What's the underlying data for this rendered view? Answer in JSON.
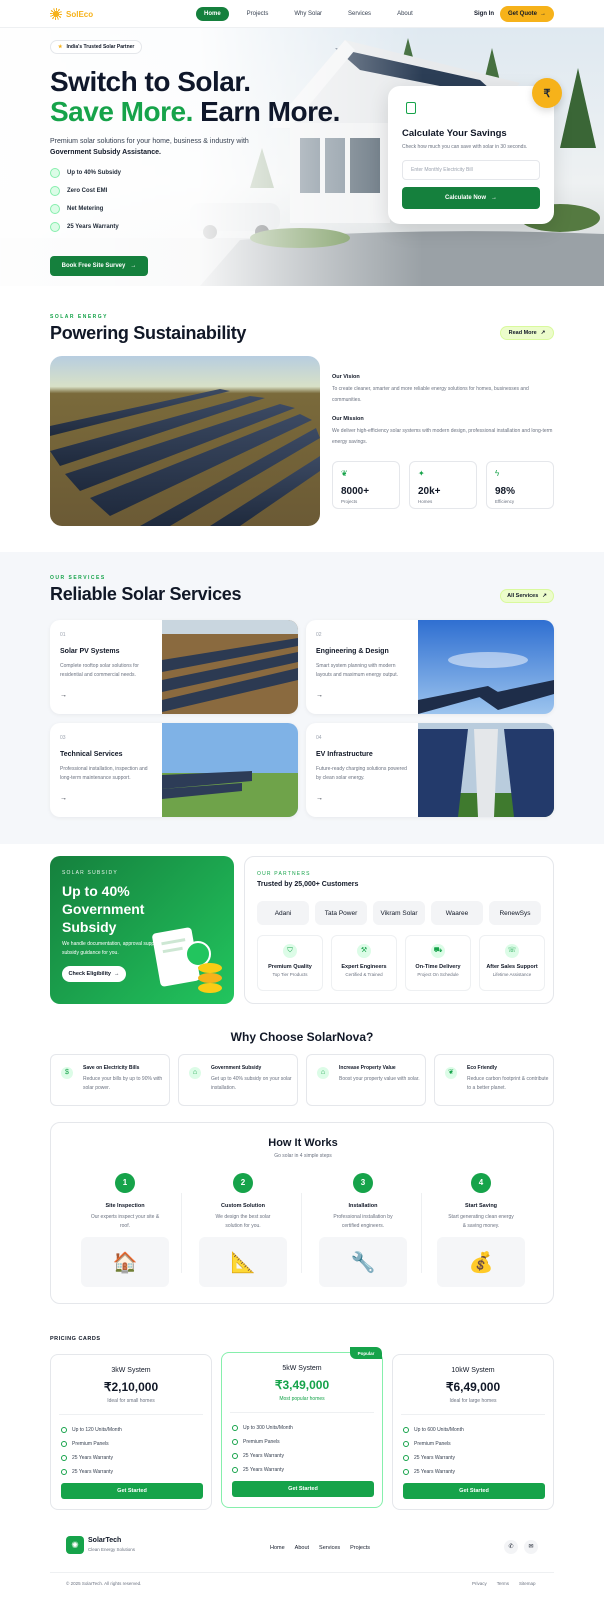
{
  "header": {
    "logo": "SolEco",
    "nav": [
      "Home",
      "Projects",
      "Why Solar",
      "Services",
      "About"
    ],
    "sign_in": "Sign In",
    "get_quote": "Get Quote",
    "quote_arrow": "→"
  },
  "hero": {
    "badge": "India's Trusted Solar Partner",
    "headline_1": "Switch to Solar.",
    "headline_2a": "Save More.",
    "headline_2b": " Earn More.",
    "desc": "Premium solar solutions for your home, business & industry with",
    "desc_bold": "Government Subsidy Assistance.",
    "features": [
      "Up to 40% Subsidy",
      "Zero Cost EMI",
      "Net Metering",
      "25 Years Warranty"
    ],
    "survey_button": "Book Free Site Survey",
    "arrow": "→",
    "coin": "₹"
  },
  "calculator": {
    "title": "Calculate Your Savings",
    "subtitle": "Check how much you can save with solar in 30 seconds.",
    "placeholder": "Enter Monthly Electricity Bill",
    "button": "Calculate Now",
    "arrow": "→"
  },
  "sustainability": {
    "eyebrow": "SOLAR ENERGY",
    "title": "Powering Sustainability",
    "read_more": "Read More",
    "arrow": "↗",
    "vision_title": "Our Vision",
    "vision_text": "To create cleaner, smarter and more reliable energy solutions for homes, businesses and communities.",
    "mission_title": "Our Mission",
    "mission_text": "We deliver high-efficiency solar systems with modern design, professional installation and long-term energy savings.",
    "stats": [
      {
        "icon": "leaf-icon",
        "value": "8000+",
        "label": "Projects"
      },
      {
        "icon": "sparkle-icon",
        "value": "20k+",
        "label": "Homes"
      },
      {
        "icon": "bolt-icon",
        "value": "98%",
        "label": "Efficiency"
      }
    ]
  },
  "services": {
    "eyebrow": "OUR SERVICES",
    "title": "Reliable Solar Services",
    "all_button": "All Services",
    "arrow": "↗",
    "cards": [
      {
        "num": "01",
        "title": "Solar PV Systems",
        "desc": "Complete rooftop solar solutions for residential and commercial needs.",
        "arrow": "→"
      },
      {
        "num": "02",
        "title": "Engineering & Design",
        "desc": "Smart system planning with modern layouts and maximum energy output.",
        "arrow": "→"
      },
      {
        "num": "03",
        "title": "Technical Services",
        "desc": "Professional installation, inspection and long-term maintenance support.",
        "arrow": "→"
      },
      {
        "num": "04",
        "title": "EV Infrastructure",
        "desc": "Future-ready charging solutions powered by clean solar energy.",
        "arrow": "→"
      }
    ]
  },
  "subsidy": {
    "eyebrow": "SOLAR SUBSIDY",
    "title": "Up to 40% Government Subsidy",
    "desc": "We handle documentation, approval support and subsidy guidance for you.",
    "button": "Check Eligibility",
    "arrow": "→"
  },
  "partners": {
    "eyebrow": "OUR PARTNERS",
    "title": "Trusted by 25,000+ Customers",
    "logos": [
      "Adani",
      "Tata Power",
      "Vikram Solar",
      "Waaree",
      "RenewSys"
    ],
    "features": [
      {
        "title": "Premium Quality",
        "sub": "Top Tier Products"
      },
      {
        "title": "Expert Engineers",
        "sub": "Certified & Trained"
      },
      {
        "title": "On-Time Delivery",
        "sub": "Project On Schedule"
      },
      {
        "title": "After Sales Support",
        "sub": "Lifetime Assistance"
      }
    ]
  },
  "why": {
    "title": "Why Choose SolarNova?",
    "items": [
      {
        "title": "Save on Electricity Bills",
        "desc": "Reduce your bills by up to 90% with solar power."
      },
      {
        "title": "Government Subsidy",
        "desc": "Get up to 40% subsidy on your solar installation."
      },
      {
        "title": "Increase Property Value",
        "desc": "Boost your property value with solar."
      },
      {
        "title": "Eco Friendly",
        "desc": "Reduce carbon footprint & contribute to a better planet."
      }
    ]
  },
  "how": {
    "title": "How It Works",
    "subtitle": "Go solar in 4 simple steps",
    "steps": [
      {
        "n": "1",
        "title": "Site Inspection",
        "desc": "Our experts inspect your site & roof.",
        "emoji": "🏠"
      },
      {
        "n": "2",
        "title": "Custom Solution",
        "desc": "We design the best solar solution for you.",
        "emoji": "📐"
      },
      {
        "n": "3",
        "title": "Installation",
        "desc": "Professional installation by certified engineers.",
        "emoji": "🔧"
      },
      {
        "n": "4",
        "title": "Start Saving",
        "desc": "Start generating clean energy & saving money.",
        "emoji": "💰"
      }
    ]
  },
  "pricing": {
    "label": "PRICING CARDS",
    "popular_tag": "Popular",
    "plans": [
      {
        "name": "3kW System",
        "price": "₹2,10,000",
        "desc": "Ideal for small homes",
        "features": [
          "Up to 120 Units/Month",
          "Premium Panels",
          "25 Years Warranty",
          "25 Years Warranty"
        ],
        "button": "Get Started"
      },
      {
        "name": "5kW System",
        "price": "₹3,49,000",
        "desc": "Most popular homes",
        "features": [
          "Up to 300 Units/Month",
          "Premium Panels",
          "25 Years Warranty",
          "25 Years Warranty"
        ],
        "button": "Get Started"
      },
      {
        "name": "10kW System",
        "price": "₹6,49,000",
        "desc": "Ideal for large homes",
        "features": [
          "Up to 600 Units/Month",
          "Premium Panels",
          "25 Years Warranty",
          "25 Years Warranty"
        ],
        "button": "Get Started"
      }
    ]
  },
  "footer": {
    "brand": "SolarTech",
    "tagline": "Clean Energy Solutions",
    "links": [
      "Home",
      "About",
      "Services",
      "Projects"
    ],
    "copyright": "© 2025 SolarTech. All rights reserved.",
    "legal": [
      "Privacy",
      "Terms",
      "Sitemap"
    ]
  },
  "colors": {
    "brand_green": "#16a34a",
    "accent_yellow": "#f6b21a"
  }
}
